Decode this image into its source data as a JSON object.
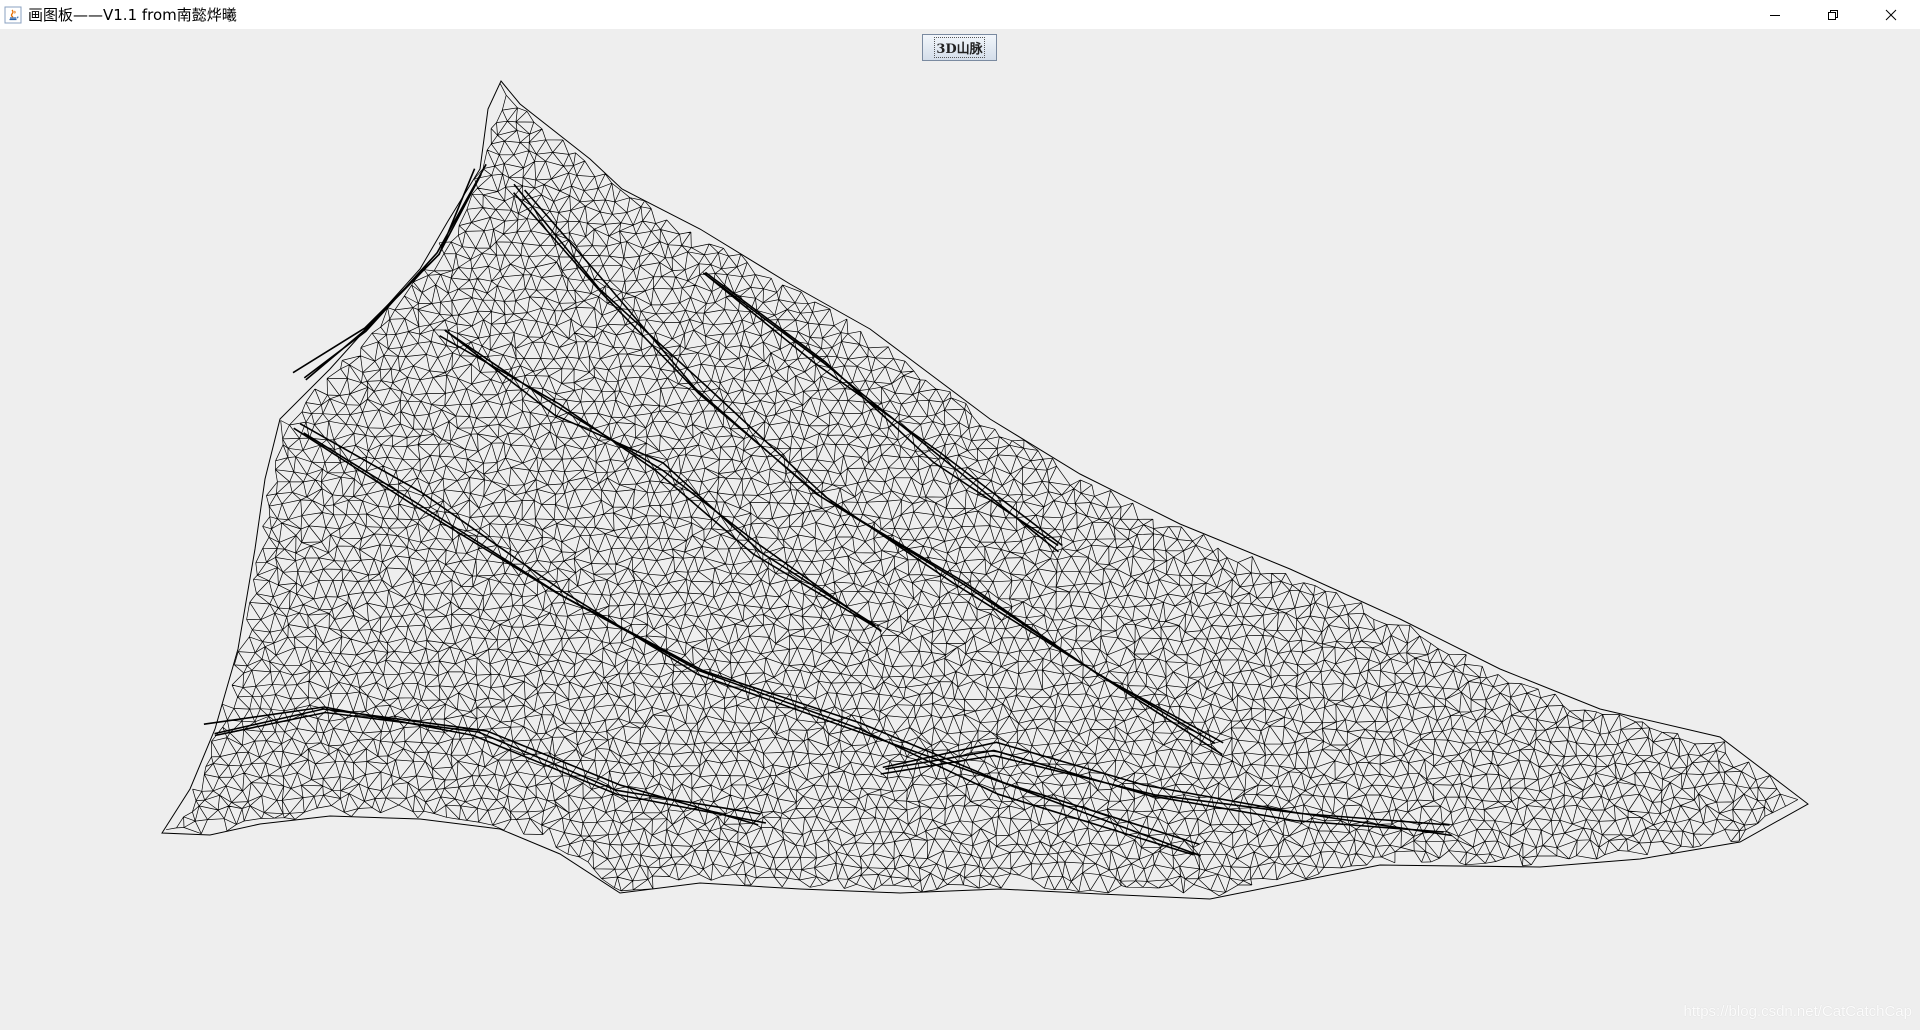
{
  "window": {
    "title": "画图板——V1.1  from南懿烨曦",
    "controls": {
      "minimize_icon": "minimize-icon",
      "restore_icon": "restore-icon",
      "close_icon": "close-icon"
    }
  },
  "toolbar": {
    "mountain_button_label": "3D山脉"
  },
  "canvas": {
    "content": "3D wireframe mountain mesh",
    "stroke_color": "#000000",
    "background_color": "#eeeeee"
  },
  "watermark": {
    "text": "https://blog.csdn.net/CatCatchCap"
  }
}
